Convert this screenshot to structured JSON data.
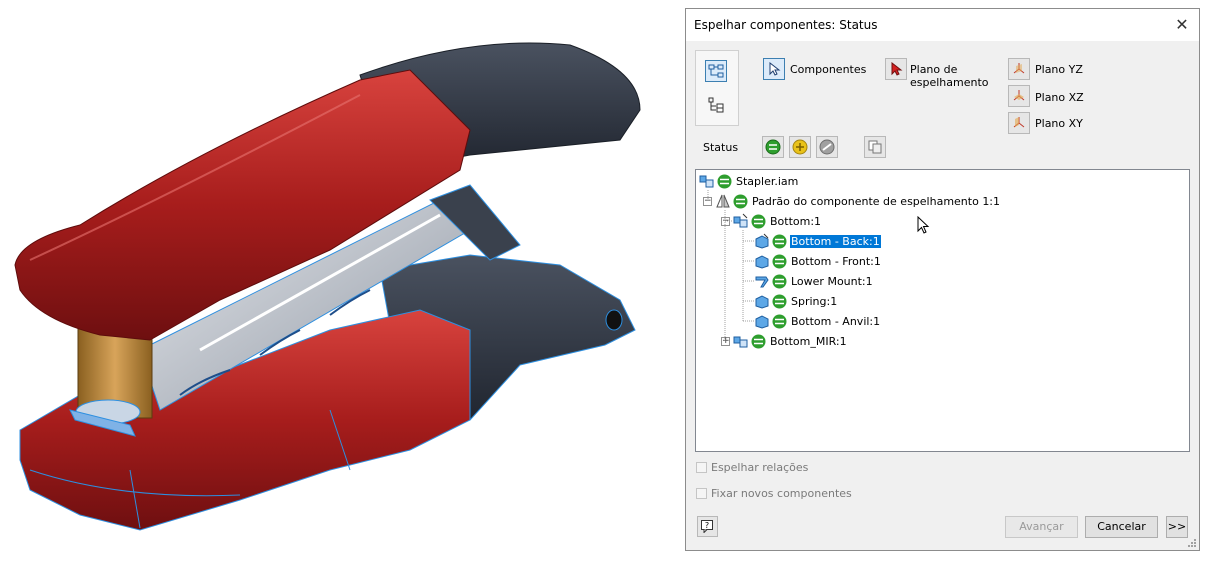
{
  "dialog": {
    "title": "Espelhar componentes: Status",
    "close_icon": "close-icon",
    "selection": {
      "components_label": "Componentes",
      "mirror_plane_label_line1": "Plano de",
      "mirror_plane_label_line2": "espelhamento",
      "plane_yz_label": "Plano YZ",
      "plane_xz_label": "Plano XZ",
      "plane_xy_label": "Plano XY"
    },
    "status_label": "Status",
    "tree": [
      {
        "label": "Stapler.iam",
        "icon": "assembly-icon"
      },
      {
        "label": "Padrão do componente de espelhamento 1:1",
        "icon": "mirror-pattern-icon"
      },
      {
        "label": "Bottom:1",
        "icon": "subassembly-icon"
      },
      {
        "label": "Bottom - Back:1",
        "icon": "part-icon",
        "selected": true
      },
      {
        "label": "Bottom - Front:1",
        "icon": "part-icon"
      },
      {
        "label": "Lower Mount:1",
        "icon": "sheetmetal-part-icon"
      },
      {
        "label": "Spring:1",
        "icon": "part-icon"
      },
      {
        "label": "Bottom - Anvil:1",
        "icon": "part-icon"
      },
      {
        "label": "Bottom_MIR:1",
        "icon": "subassembly-icon"
      }
    ],
    "options": {
      "mirror_relations_label": "Espelhar relações",
      "mirror_relations_checked": false,
      "fix_new_components_label": "Fixar novos componentes",
      "fix_new_components_checked": false
    },
    "footer": {
      "next_label": "Avançar",
      "cancel_label": "Cancelar",
      "more_label": ">>"
    }
  },
  "colors": {
    "stapler_red": "#b0201f",
    "stapler_dark": "#2c3340",
    "edge_blue": "#2d8fe0",
    "status_green": "#2e9e2e",
    "status_yellow": "#e9c21a",
    "selection_blue": "#0078d7"
  }
}
